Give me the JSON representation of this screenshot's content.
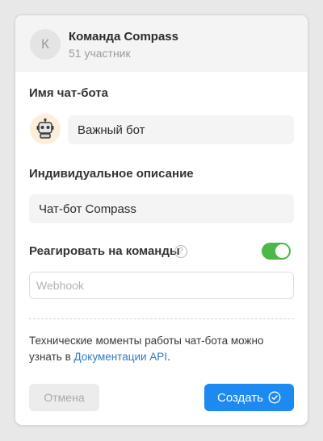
{
  "team": {
    "avatar_letter": "К",
    "name": "Команда Compass",
    "members": "51 участник"
  },
  "bot_name": {
    "label": "Имя чат-бота",
    "avatar_icon": "robot-icon",
    "value": "Важный бот"
  },
  "description": {
    "label": "Индивидуальное описание",
    "value": "Чат-бот Compass"
  },
  "commands": {
    "label": "Реагировать на команды",
    "help_icon": "?",
    "toggle_on": true,
    "toggle_color": "#4cb848"
  },
  "webhook": {
    "placeholder": "Webhook",
    "value": ""
  },
  "info": {
    "text_before": "Технические моменты работы чат-бота можно узнать в ",
    "link_text": "Документации API",
    "text_after": "."
  },
  "buttons": {
    "cancel_label": "Отмена",
    "create_label": "Создать",
    "create_icon": "check-circle-icon",
    "accent_color": "#1d8af1"
  }
}
